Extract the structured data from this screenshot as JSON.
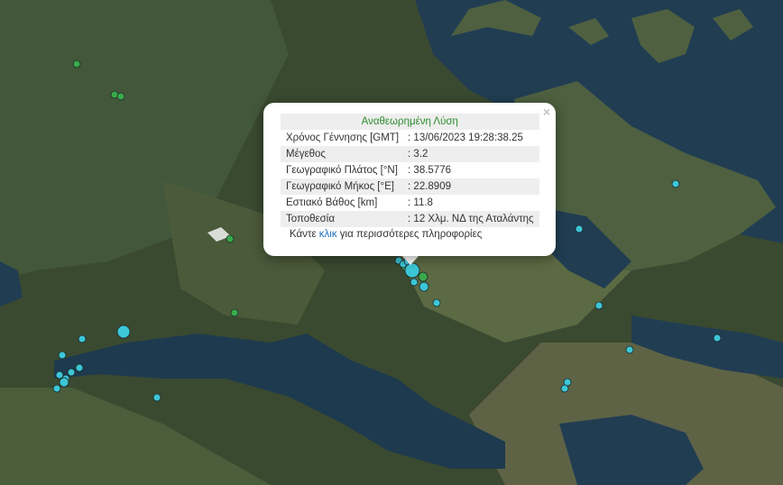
{
  "popup": {
    "title": "Αναθεωρημένη Λύση",
    "rows": [
      {
        "label": "Χρόνος Γέννησης [GMT]",
        "value": ": 13/06/2023 19:28:38.25"
      },
      {
        "label": "Μέγεθος",
        "value": ": 3.2"
      },
      {
        "label": "Γεωγραφικό Πλάτος [°N]",
        "value": ": 38.5776"
      },
      {
        "label": "Γεωγραφικό Μήκος [°E]",
        "value": ": 22.8909"
      },
      {
        "label": "Εστιακό Βάθος [km]",
        "value": ": 11.8"
      },
      {
        "label": "Τοποθεσία",
        "value": ": 12 Χλμ. ΝΔ της Αταλάντης"
      }
    ],
    "more_prefix": "Κάντε ",
    "more_link": "κλικ",
    "more_suffix": " για περισσότερες πληροφορίες",
    "close": "×"
  },
  "colors": {
    "recent_marker": "#3cc6d6",
    "older_marker": "#3aa84a",
    "title_green": "#2e8b2e",
    "link_blue": "#1f6fbf"
  }
}
